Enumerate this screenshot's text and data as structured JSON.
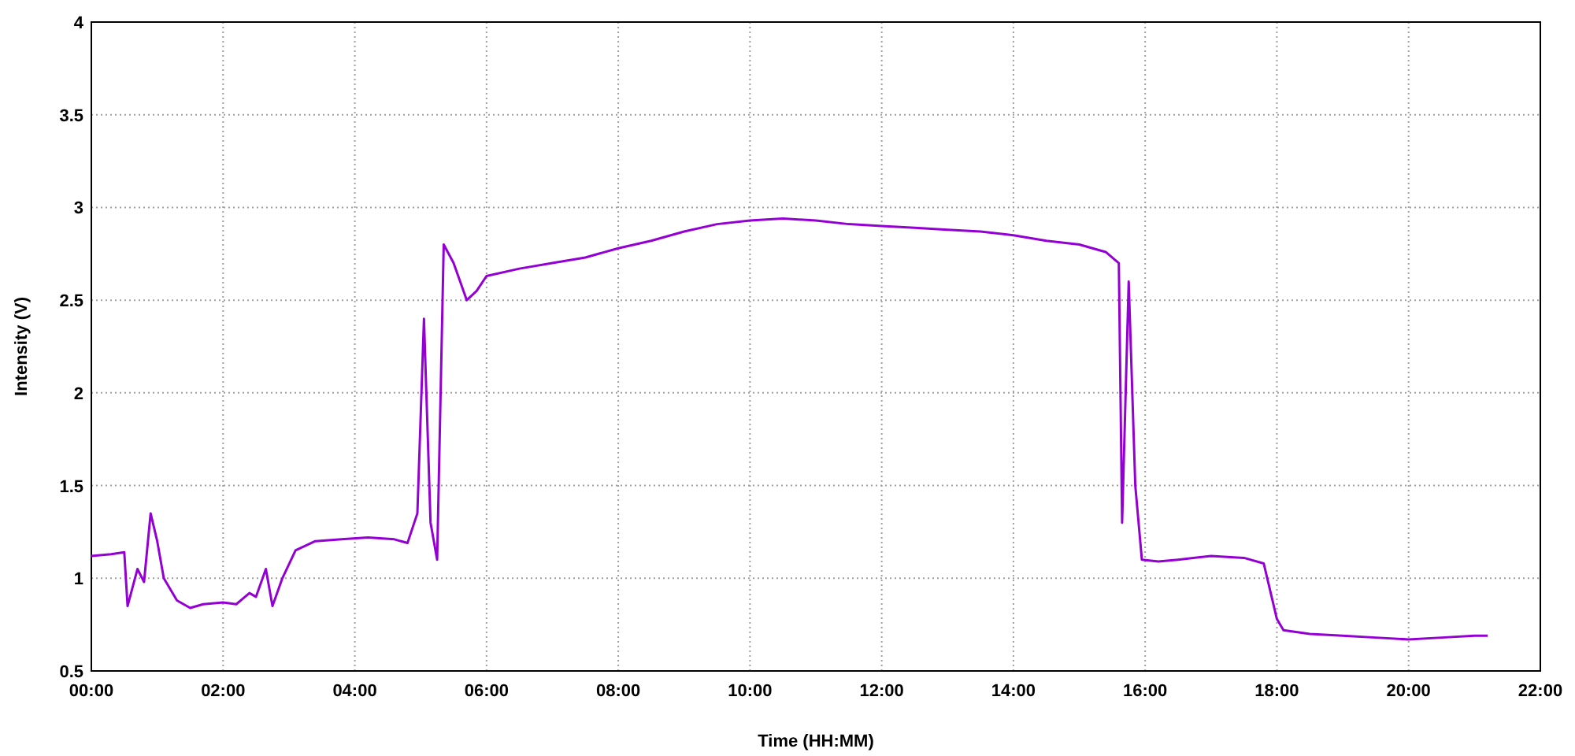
{
  "chart_data": {
    "type": "line",
    "grid": true,
    "xlabel": "Time (HH:MM)",
    "ylabel": "Intensity (V)",
    "xlim": [
      0,
      22
    ],
    "ylim": [
      0.5,
      4
    ],
    "xticks": [
      {
        "value": 0,
        "label": "00:00"
      },
      {
        "value": 2,
        "label": "02:00"
      },
      {
        "value": 4,
        "label": "04:00"
      },
      {
        "value": 6,
        "label": "06:00"
      },
      {
        "value": 8,
        "label": "08:00"
      },
      {
        "value": 10,
        "label": "10:00"
      },
      {
        "value": 12,
        "label": "12:00"
      },
      {
        "value": 14,
        "label": "14:00"
      },
      {
        "value": 16,
        "label": "16:00"
      },
      {
        "value": 18,
        "label": "18:00"
      },
      {
        "value": 20,
        "label": "20:00"
      },
      {
        "value": 22,
        "label": "22:00"
      }
    ],
    "yticks": [
      {
        "value": 0.5,
        "label": "0.5"
      },
      {
        "value": 1,
        "label": "1"
      },
      {
        "value": 1.5,
        "label": "1.5"
      },
      {
        "value": 2,
        "label": "2"
      },
      {
        "value": 2.5,
        "label": "2.5"
      },
      {
        "value": 3,
        "label": "3"
      },
      {
        "value": 3.5,
        "label": "3.5"
      },
      {
        "value": 4,
        "label": "4"
      }
    ],
    "x": [
      0,
      0.3,
      0.5,
      0.55,
      0.7,
      0.8,
      0.9,
      1.0,
      1.1,
      1.3,
      1.5,
      1.7,
      2.0,
      2.2,
      2.4,
      2.5,
      2.65,
      2.75,
      2.9,
      3.1,
      3.4,
      3.8,
      4.2,
      4.6,
      4.8,
      4.95,
      5.05,
      5.15,
      5.25,
      5.35,
      5.5,
      5.7,
      5.85,
      6.0,
      6.5,
      7.0,
      7.5,
      8.0,
      8.5,
      9.0,
      9.5,
      10.0,
      10.5,
      11.0,
      11.5,
      12.0,
      12.5,
      13.0,
      13.5,
      14.0,
      14.5,
      15.0,
      15.4,
      15.6,
      15.65,
      15.75,
      15.85,
      15.95,
      16.2,
      16.5,
      17.0,
      17.5,
      17.8,
      18.0,
      18.1,
      18.5,
      19.0,
      19.5,
      20.0,
      20.5,
      21.0,
      21.2
    ],
    "series": [
      {
        "color": "#9400d3",
        "values": [
          1.12,
          1.13,
          1.14,
          0.85,
          1.05,
          0.98,
          1.35,
          1.2,
          1.0,
          0.88,
          0.84,
          0.86,
          0.87,
          0.86,
          0.92,
          0.9,
          1.05,
          0.85,
          1.0,
          1.15,
          1.2,
          1.21,
          1.22,
          1.21,
          1.19,
          1.35,
          2.4,
          1.3,
          1.1,
          2.8,
          2.7,
          2.5,
          2.55,
          2.63,
          2.67,
          2.7,
          2.73,
          2.78,
          2.82,
          2.87,
          2.91,
          2.93,
          2.94,
          2.93,
          2.91,
          2.9,
          2.89,
          2.88,
          2.87,
          2.85,
          2.82,
          2.8,
          2.76,
          2.7,
          1.3,
          2.6,
          1.5,
          1.1,
          1.09,
          1.1,
          1.12,
          1.11,
          1.08,
          0.78,
          0.72,
          0.7,
          0.69,
          0.68,
          0.67,
          0.68,
          0.69,
          0.69
        ]
      }
    ]
  }
}
